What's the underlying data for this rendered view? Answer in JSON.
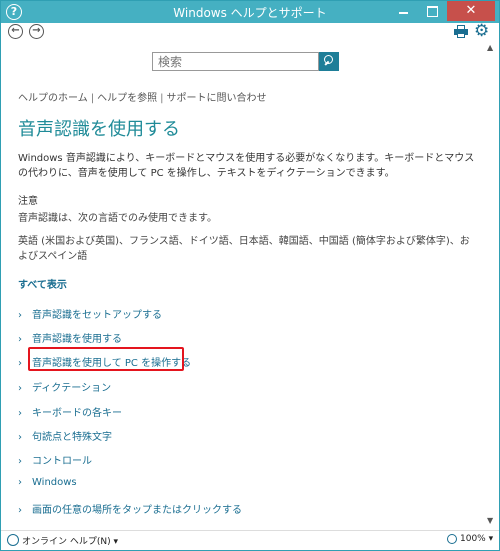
{
  "window": {
    "title": "Windows ヘルプとサポート",
    "close_label": "✕"
  },
  "toolbar": {
    "back_label": "←",
    "forward_label": "→"
  },
  "search": {
    "placeholder": "検索"
  },
  "breadcrumb": {
    "home": "ヘルプのホーム",
    "browse": "ヘルプを参照",
    "contact": "サポートに問い合わせ",
    "separator": "|"
  },
  "article": {
    "title": "音声認識を使用する",
    "intro": "Windows 音声認識により、キーボードとマウスを使用する必要がなくなります。キーボードとマウスの代わりに、音声を使用して PC を操作し、テキストをディクテーションできます。",
    "note_label": "注意",
    "note_text": "音声認識は、次の言語でのみ使用できます。",
    "languages": "英語 (米国および英国)、フランス語、ドイツ語、日本語、韓国語、中国語 (簡体字および繁体字)、およびスペイン語",
    "show_all": "すべて表示",
    "chevron": "›",
    "topics": [
      "音声認識をセットアップする",
      "音声認識を使用する",
      "音声認識を使用して PC を操作する",
      "ディクテーション",
      "キーボードの各キー",
      "句読点と特殊文字",
      "コントロール",
      "Windows",
      "画面の任意の場所をタップまたはクリックする"
    ]
  },
  "statusbar": {
    "online_help": "オンライン ヘルプ(N) ▾",
    "zoom": "100% ▾"
  },
  "colors": {
    "accent": "#45b0c2",
    "link": "#1a6e91",
    "highlight": "#e4151e"
  }
}
